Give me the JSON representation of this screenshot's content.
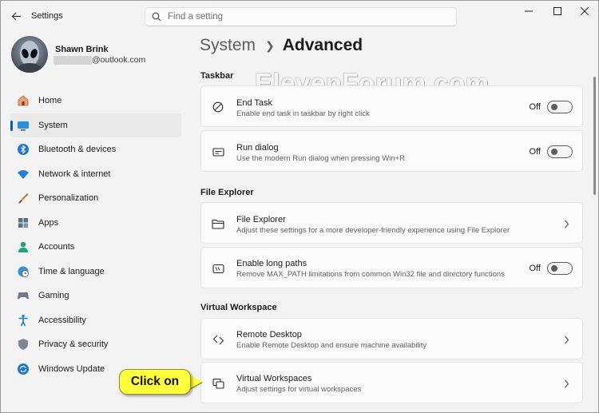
{
  "app": {
    "title": "Settings"
  },
  "search": {
    "placeholder": "Find a setting"
  },
  "user": {
    "name": "Shawn Brink",
    "email_visible": "@outlook.com"
  },
  "sidebar": {
    "items": [
      {
        "label": "Home",
        "icon": "home-icon"
      },
      {
        "label": "System",
        "icon": "system-icon",
        "active": true
      },
      {
        "label": "Bluetooth & devices",
        "icon": "bluetooth-icon"
      },
      {
        "label": "Network & internet",
        "icon": "wifi-icon"
      },
      {
        "label": "Personalization",
        "icon": "brush-icon"
      },
      {
        "label": "Apps",
        "icon": "apps-icon"
      },
      {
        "label": "Accounts",
        "icon": "accounts-icon"
      },
      {
        "label": "Time & language",
        "icon": "globe-clock-icon"
      },
      {
        "label": "Gaming",
        "icon": "gamepad-icon"
      },
      {
        "label": "Accessibility",
        "icon": "accessibility-icon"
      },
      {
        "label": "Privacy & security",
        "icon": "shield-icon"
      },
      {
        "label": "Windows Update",
        "icon": "update-icon"
      }
    ]
  },
  "breadcrumb": {
    "parent": "System",
    "current": "Advanced"
  },
  "watermark": "ElevenForum.com",
  "sections": {
    "taskbar": {
      "title": "Taskbar",
      "items": [
        {
          "title": "End Task",
          "desc": "Enable end task in taskbar by right click",
          "state": "Off",
          "icon": "end-task-icon"
        },
        {
          "title": "Run dialog",
          "desc": "Use the modern Run dialog when pressing Win+R",
          "state": "Off",
          "icon": "run-dialog-icon"
        }
      ]
    },
    "file_explorer": {
      "title": "File Explorer",
      "items": [
        {
          "title": "File Explorer",
          "desc": "Adjust these settings for a more developer-friendly experience using File Explorer",
          "icon": "folder-icon"
        },
        {
          "title": "Enable long paths",
          "desc": "Remove MAX_PATH limitations from common Win32 file and directory functions",
          "state": "Off",
          "icon": "long-path-icon"
        }
      ]
    },
    "virtual_workspace": {
      "title": "Virtual Workspace",
      "items": [
        {
          "title": "Remote Desktop",
          "desc": "Enable Remote Desktop and ensure machine availability",
          "icon": "remote-desktop-icon"
        },
        {
          "title": "Virtual Workspaces",
          "desc": "Adjust settings for virtual workspaces",
          "icon": "virtual-workspace-icon"
        }
      ]
    }
  },
  "callout": {
    "text": "Click on"
  },
  "colors": {
    "accent": "#005fb8",
    "callout": "#ffff3c"
  }
}
